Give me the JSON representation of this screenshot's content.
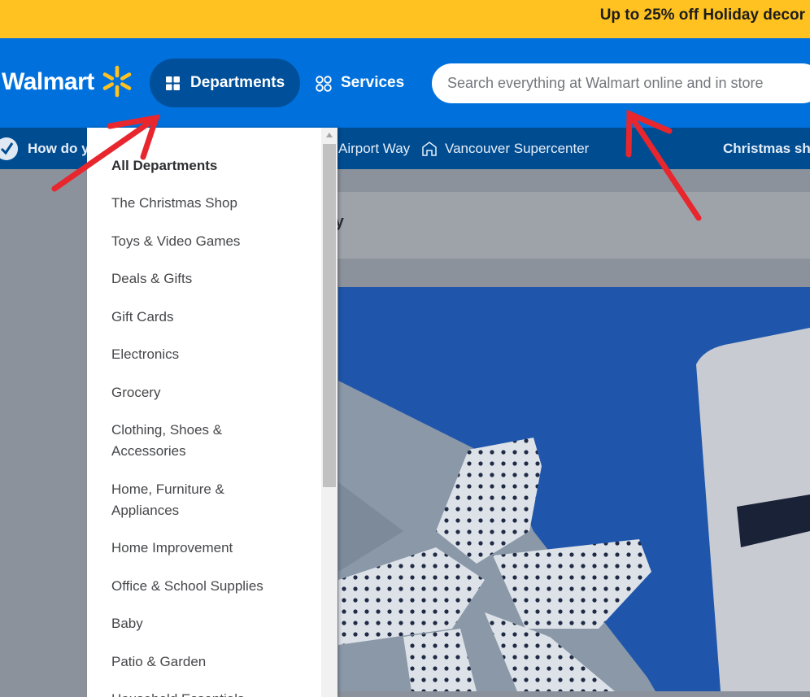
{
  "promo": {
    "text": "Up to 25% off Holiday decor"
  },
  "header": {
    "logo_text": "Walmart",
    "departments_label": "Departments",
    "services_label": "Services",
    "search_placeholder": "Search everything at Walmart online and in store"
  },
  "subbar": {
    "how_do_text": "How do yo",
    "street_text": "Airport Way",
    "store_name": "Vancouver Supercenter",
    "christmas_link": "Christmas sho"
  },
  "page": {
    "crumb_fragment": "ry"
  },
  "departments_menu": {
    "items": [
      "All Departments",
      "The Christmas Shop",
      "Toys & Video Games",
      "Deals & Gifts",
      "Gift Cards",
      "Electronics",
      "Grocery",
      "Clothing, Shoes & Accessories",
      "Home, Furniture & Appliances",
      "Home Improvement",
      "Office & School Supplies",
      "Baby",
      "Patio & Garden",
      "Household Essentials"
    ]
  },
  "colors": {
    "promo_bg": "#ffc220",
    "header_bg": "#0071dc",
    "departments_btn_bg": "#004f9a",
    "subbar_bg": "#004c91",
    "spark": "#ffc220",
    "annotation_arrow": "#e8262e"
  },
  "icons": [
    "spark-icon",
    "grid-icon",
    "services-icon",
    "checkmark-badge-icon",
    "store-icon"
  ]
}
